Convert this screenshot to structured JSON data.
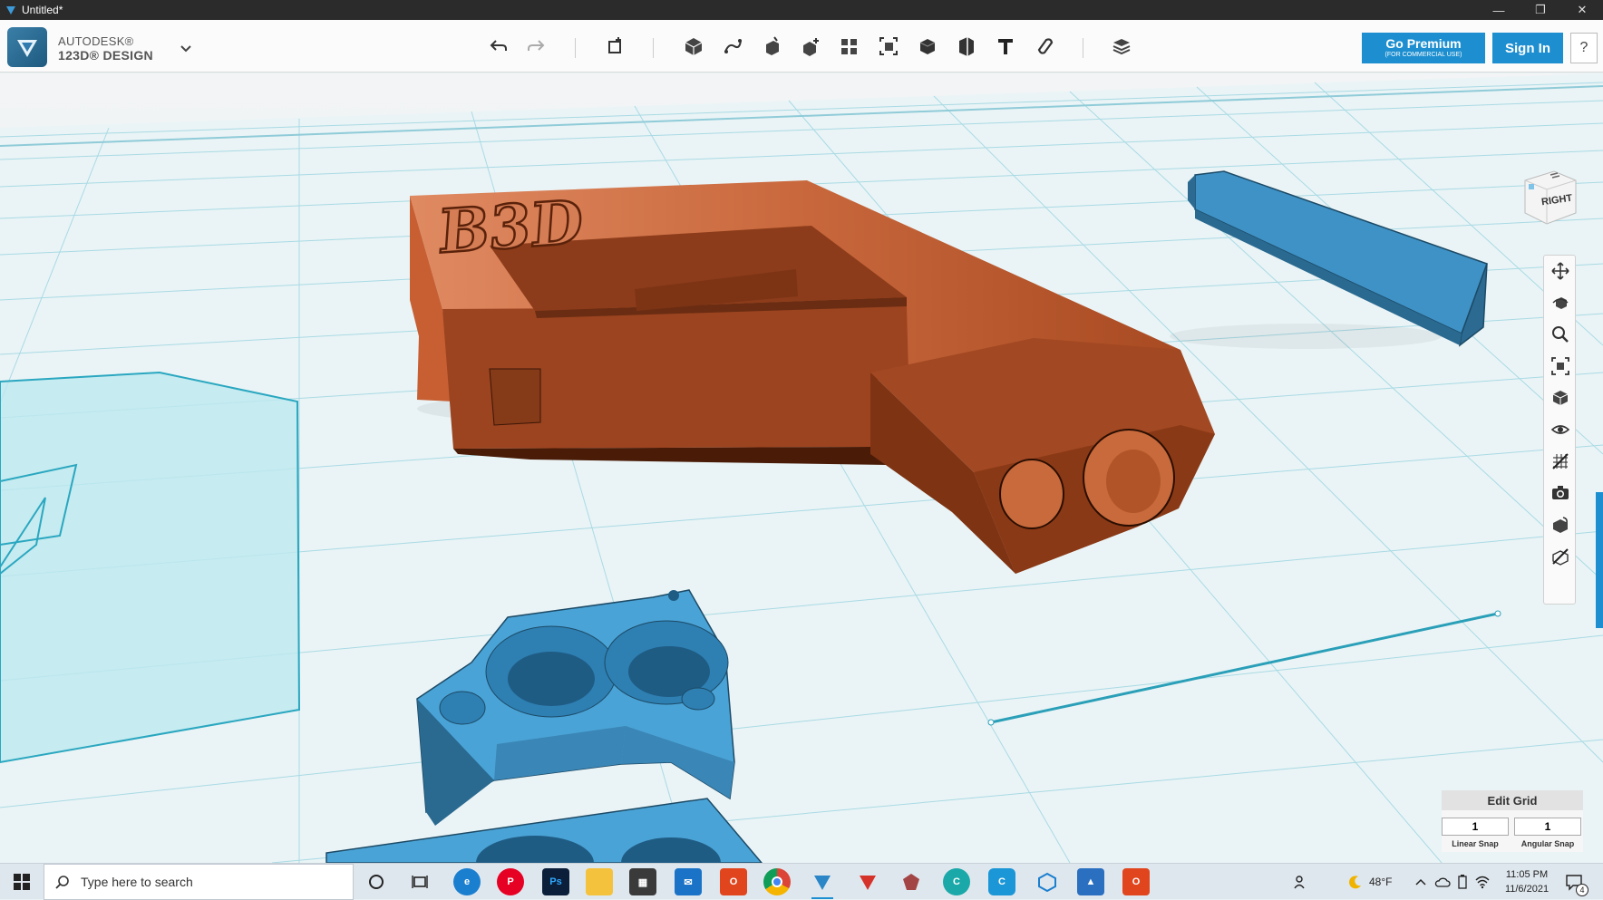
{
  "window": {
    "title": "Untitled*",
    "minimize": "—",
    "restore": "❐",
    "close": "✕"
  },
  "brand": {
    "line1": "AUTODESK®",
    "line2": "123D® DESIGN"
  },
  "header": {
    "premium_label": "Go Premium",
    "premium_sub": "(FOR COMMERCIAL USE)",
    "signin_label": "Sign In",
    "help_label": "?"
  },
  "toolbar_tools": [
    "undo",
    "redo",
    "transform",
    "primitives",
    "sketch",
    "construct",
    "modify",
    "pattern",
    "grouping",
    "combine",
    "measure",
    "text",
    "snap",
    "material"
  ],
  "model": {
    "engraved_text": "B3D"
  },
  "viewcube": {
    "face_label": "RIGHT"
  },
  "nav_tools": [
    "pan",
    "orbit",
    "zoom",
    "fit",
    "views",
    "visibility",
    "grid-toggle",
    "screenshot",
    "materials",
    "outlines"
  ],
  "edit_grid": {
    "title": "Edit Grid",
    "linear_snap_value": "1",
    "angular_snap_value": "1",
    "linear_snap_label": "Linear Snap",
    "angular_snap_label": "Angular Snap"
  },
  "taskbar": {
    "search_placeholder": "Type here to search",
    "weather": "48°F",
    "time": "11:05 PM",
    "date": "11/6/2021",
    "notification_count": "4"
  },
  "colors": {
    "accent": "#1d8fd0",
    "model_orange": "#b5532a",
    "model_blue": "#4aa3d6",
    "grid_line": "#9fd3df"
  }
}
